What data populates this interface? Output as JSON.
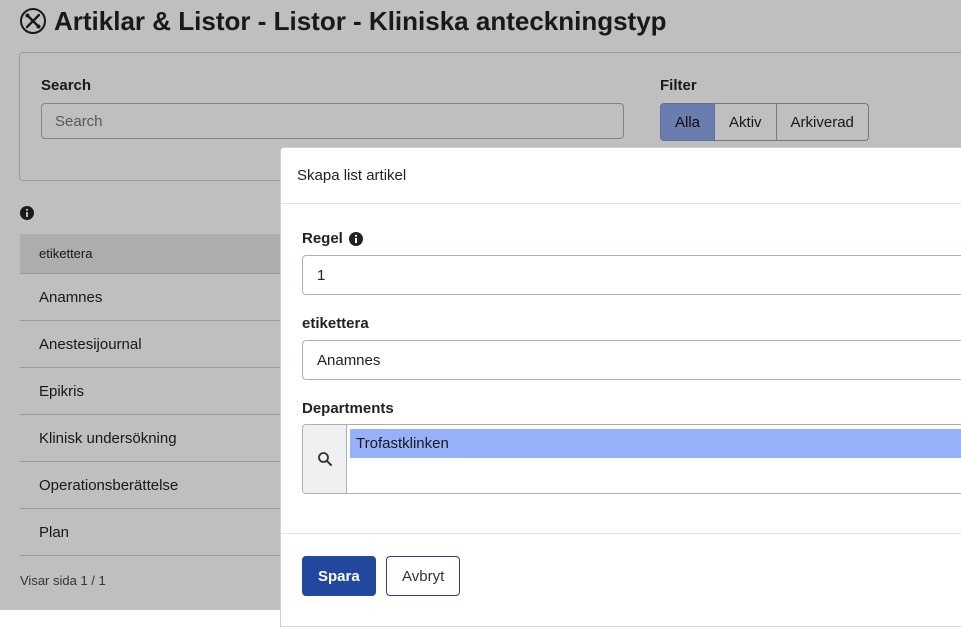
{
  "page": {
    "title": "Artiklar & Listor - Listor - Kliniska anteckningstyp",
    "title_icon": "tools-icon"
  },
  "search_panel": {
    "search_label": "Search",
    "search_placeholder": "Search",
    "filter_label": "Filter",
    "filters": [
      {
        "label": "Alla",
        "active": true
      },
      {
        "label": "Aktiv",
        "active": false
      },
      {
        "label": "Arkiverad",
        "active": false
      }
    ]
  },
  "list": {
    "info_icon": "info-icon",
    "column_header": "etikettera",
    "rows": [
      "Anamnes",
      "Anestesijournal",
      "Epikris",
      "Klinisk undersökning",
      "Operationsberättelse",
      "Plan"
    ],
    "pager": "Visar sida 1 / 1"
  },
  "modal": {
    "title": "Skapa list artikel",
    "rule_label": "Regel",
    "rule_value": "1",
    "label_label": "etikettera",
    "label_value": "Anamnes",
    "departments_label": "Departments",
    "departments": [
      "Trofastklinken"
    ],
    "save_label": "Spara",
    "cancel_label": "Avbryt"
  },
  "colors": {
    "accent": "#21479e",
    "filter_active": "#8fa6e8",
    "selected_department": "#96b1fa"
  }
}
